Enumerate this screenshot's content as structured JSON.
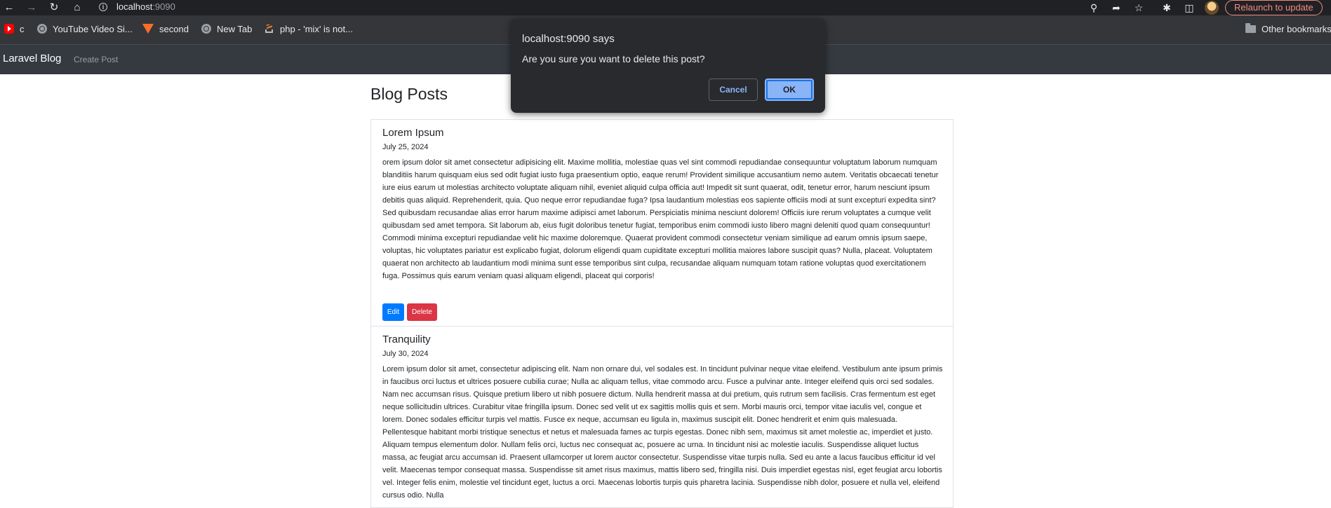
{
  "browser": {
    "url_host": "localhost",
    "url_port": ":9090",
    "relaunch_label": "Relaunch to update",
    "bookmarks": [
      {
        "label": "c",
        "icon": "youtube-icon"
      },
      {
        "label": "YouTube Video Si...",
        "icon": "globe-icon"
      },
      {
        "label": "second",
        "icon": "gitlab-icon"
      },
      {
        "label": "New Tab",
        "icon": "globe-icon"
      },
      {
        "label": "php - 'mix' is not...",
        "icon": "stackoverflow-icon"
      }
    ],
    "other_bookmarks": "Other bookmarks"
  },
  "navbar": {
    "brand": "Laravel Blog",
    "create_link": "Create Post"
  },
  "page": {
    "title": "Blog Posts"
  },
  "posts": [
    {
      "title": "Lorem Ipsum",
      "date": "July 25, 2024",
      "body": "orem ipsum dolor sit amet consectetur adipisicing elit. Maxime mollitia, molestiae quas vel sint commodi repudiandae consequuntur voluptatum laborum numquam blanditiis harum quisquam eius sed odit fugiat iusto fuga praesentium optio, eaque rerum! Provident similique accusantium nemo autem. Veritatis obcaecati tenetur iure eius earum ut molestias architecto voluptate aliquam nihil, eveniet aliquid culpa officia aut! Impedit sit sunt quaerat, odit, tenetur error, harum nesciunt ipsum debitis quas aliquid. Reprehenderit, quia. Quo neque error repudiandae fuga? Ipsa laudantium molestias eos sapiente officiis modi at sunt excepturi expedita sint? Sed quibusdam recusandae alias error harum maxime adipisci amet laborum. Perspiciatis minima nesciunt dolorem! Officiis iure rerum voluptates a cumque velit quibusdam sed amet tempora. Sit laborum ab, eius fugit doloribus tenetur fugiat, temporibus enim commodi iusto libero magni deleniti quod quam consequuntur! Commodi minima excepturi repudiandae velit hic maxime doloremque. Quaerat provident commodi consectetur veniam similique ad earum omnis ipsum saepe, voluptas, hic voluptates pariatur est explicabo fugiat, dolorum eligendi quam cupiditate excepturi mollitia maiores labore suscipit quas? Nulla, placeat. Voluptatem quaerat non architecto ab laudantium modi minima sunt esse temporibus sint culpa, recusandae aliquam numquam totam ratione voluptas quod exercitationem fuga. Possimus quis earum veniam quasi aliquam eligendi, placeat qui corporis!",
      "edit_label": "Edit",
      "delete_label": "Delete"
    },
    {
      "title": "Tranquility",
      "date": "July 30, 2024",
      "body": "Lorem ipsum dolor sit amet, consectetur adipiscing elit. Nam non ornare dui, vel sodales est. In tincidunt pulvinar neque vitae eleifend. Vestibulum ante ipsum primis in faucibus orci luctus et ultrices posuere cubilia curae; Nulla ac aliquam tellus, vitae commodo arcu. Fusce a pulvinar ante. Integer eleifend quis orci sed sodales. Nam nec accumsan risus. Quisque pretium libero ut nibh posuere dictum. Nulla hendrerit massa at dui pretium, quis rutrum sem facilisis. Cras fermentum est eget neque sollicitudin ultrices. Curabitur vitae fringilla ipsum. Donec sed velit ut ex sagittis mollis quis et sem. Morbi mauris orci, tempor vitae iaculis vel, congue et lorem. Donec sodales efficitur turpis vel mattis. Fusce ex neque, accumsan eu ligula in, maximus suscipit elit. Donec hendrerit et enim quis malesuada. Pellentesque habitant morbi tristique senectus et netus et malesuada fames ac turpis egestas. Donec nibh sem, maximus sit amet molestie ac, imperdiet et justo. Aliquam tempus elementum dolor. Nullam felis orci, luctus nec consequat ac, posuere ac urna. In tincidunt nisi ac molestie iaculis. Suspendisse aliquet luctus massa, ac feugiat arcu accumsan id. Praesent ullamcorper ut lorem auctor consectetur. Suspendisse vitae turpis nulla. Sed eu ante a lacus faucibus efficitur id vel velit. Maecenas tempor consequat massa. Suspendisse sit amet risus maximus, mattis libero sed, fringilla nisi. Duis imperdiet egestas nisl, eget feugiat arcu lobortis vel. Integer felis enim, molestie vel tincidunt eget, luctus a orci. Maecenas lobortis turpis quis pharetra lacinia. Suspendisse nibh dolor, posuere et nulla vel, eleifend cursus odio. Nulla"
    }
  ],
  "dialog": {
    "title": "localhost:9090 says",
    "message": "Are you sure you want to delete this post?",
    "cancel_label": "Cancel",
    "ok_label": "OK"
  }
}
